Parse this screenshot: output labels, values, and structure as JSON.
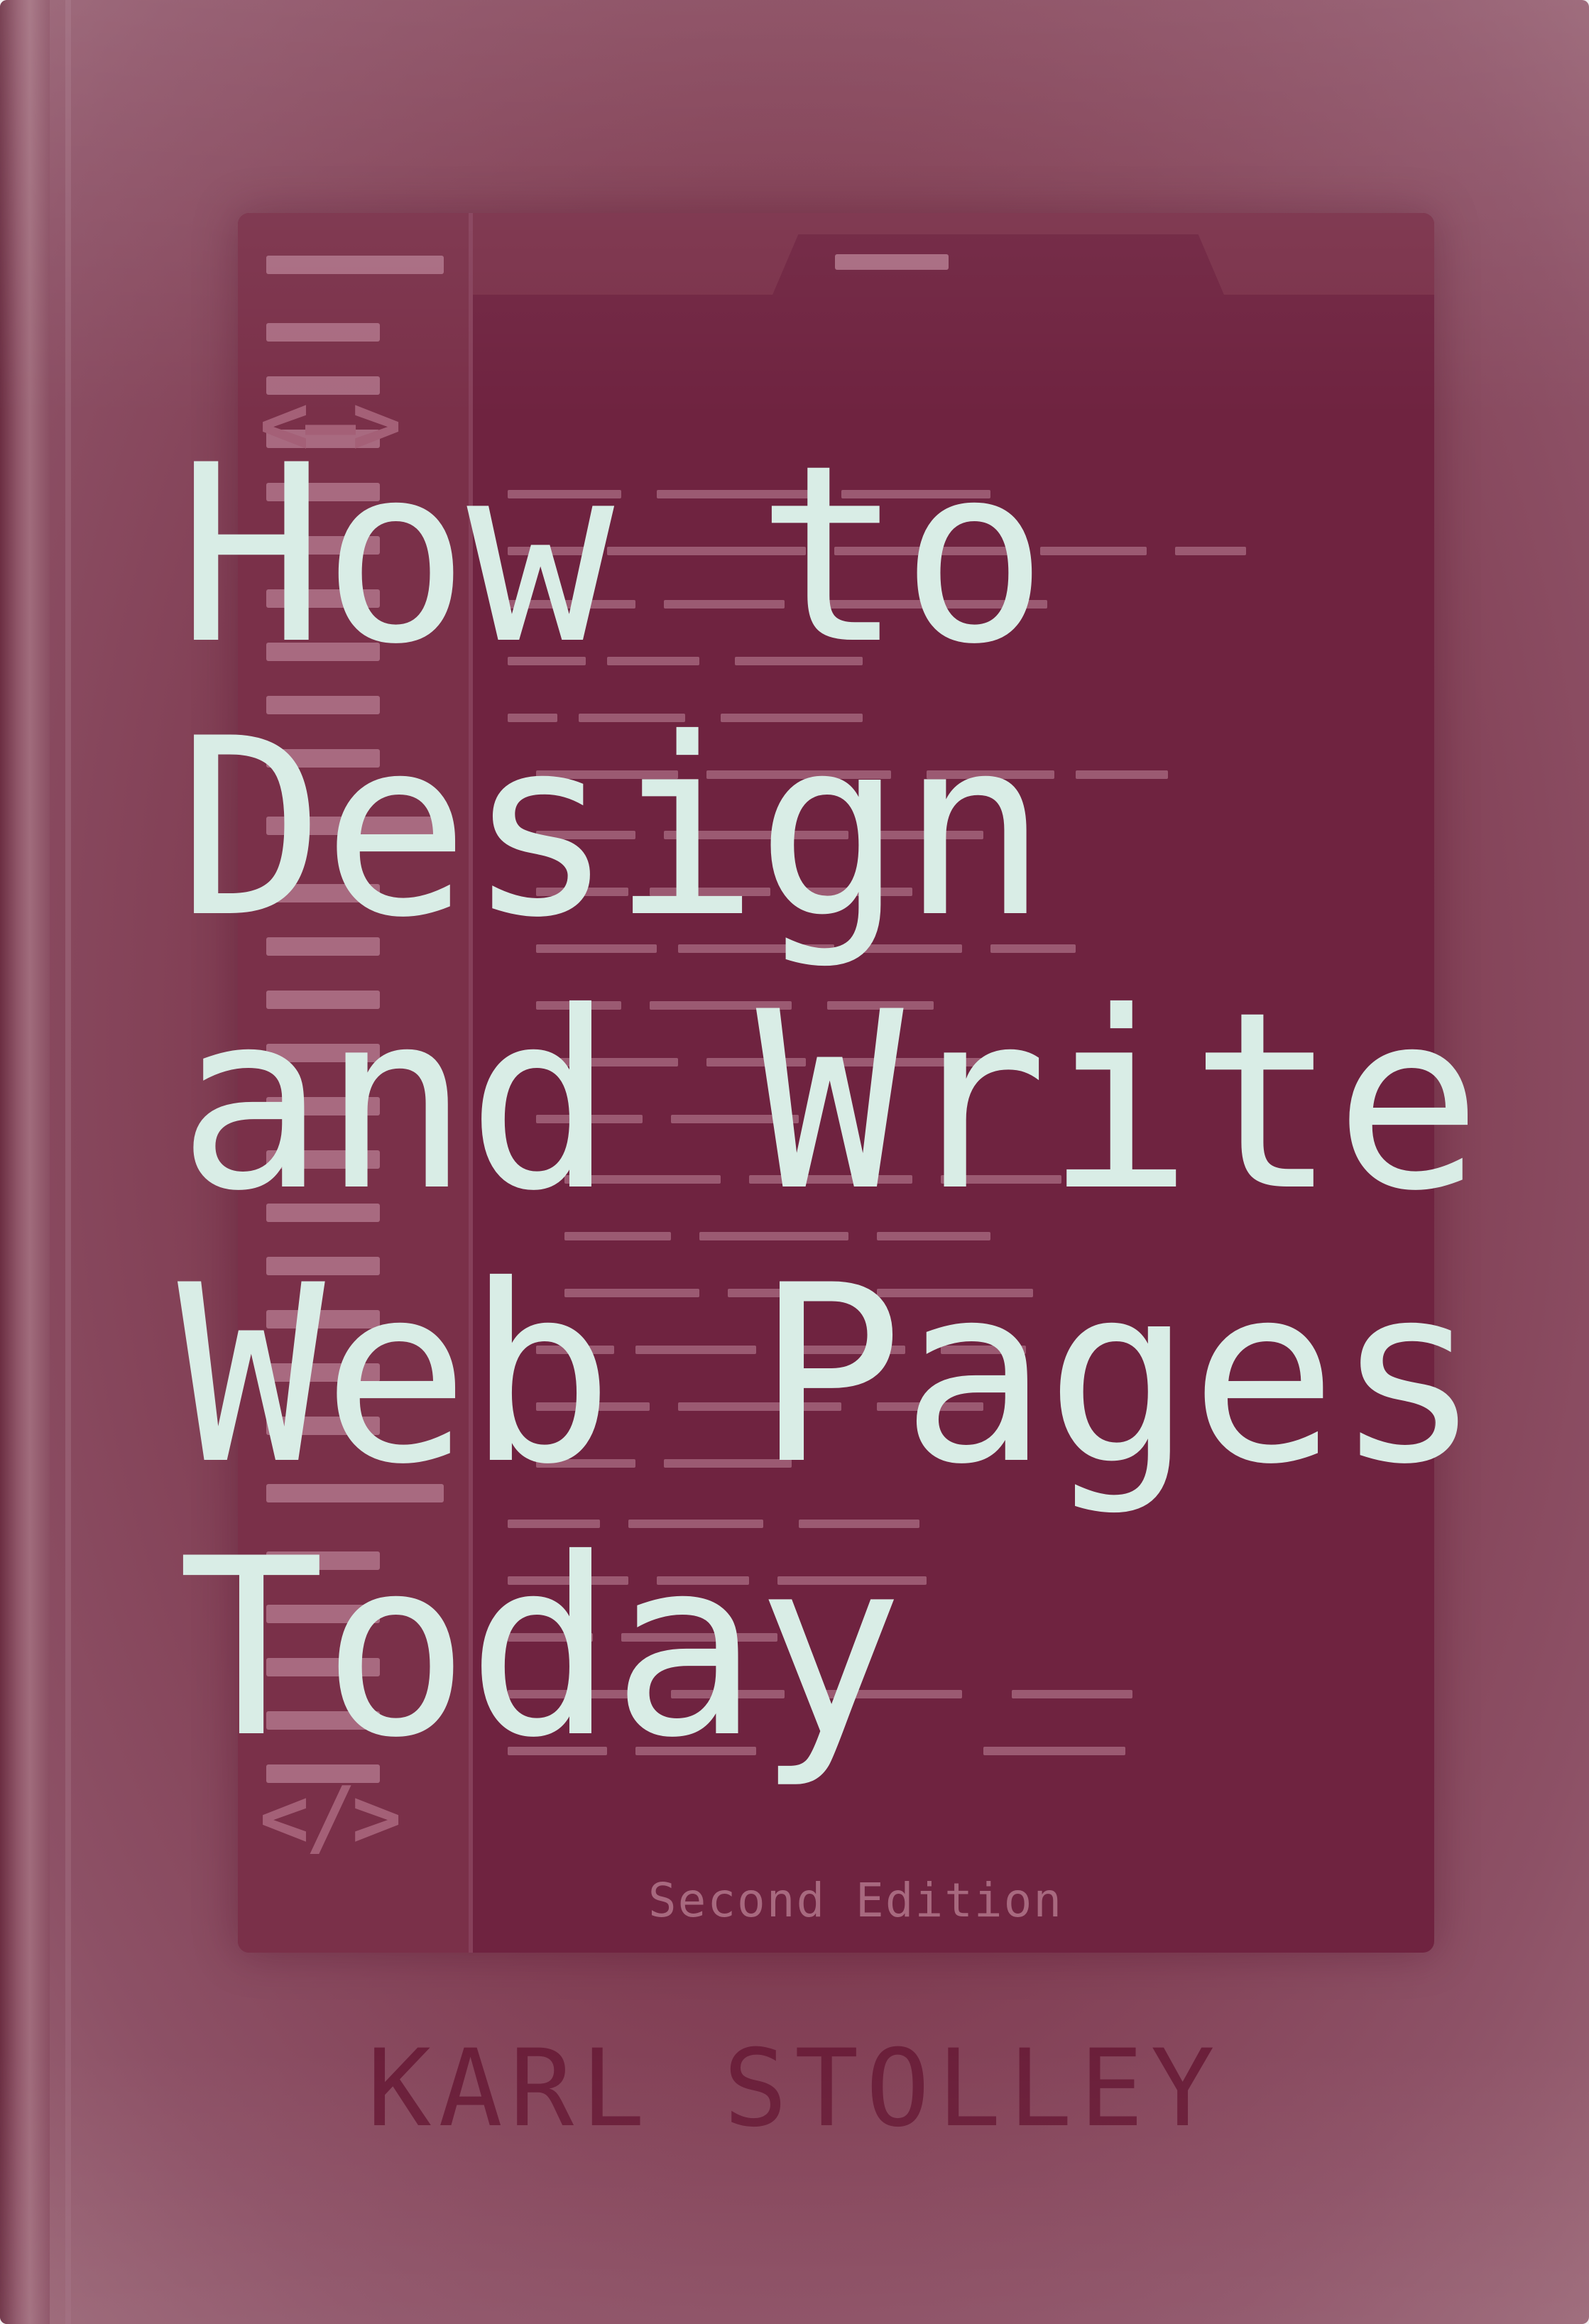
{
  "book": {
    "title_lines": [
      "How to",
      "Design",
      "and Write",
      "Web Pages",
      "Today"
    ],
    "edition": "Second Edition",
    "author": "KARL STOLLEY"
  },
  "illustration": {
    "open_tag": "<–>",
    "close_tag": "</>"
  },
  "colors": {
    "cover": "#86374f",
    "title": "#d9ede6",
    "author": "#6b1f3a",
    "editor_panel": "#6f2340"
  }
}
